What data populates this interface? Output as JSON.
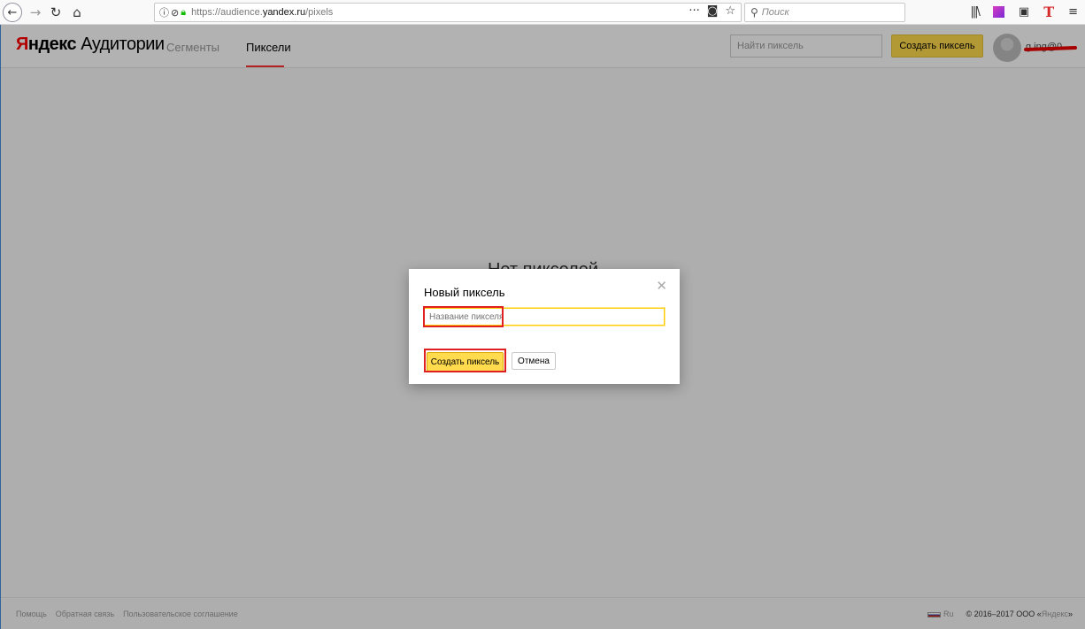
{
  "browser": {
    "url_scheme": "https://audience.",
    "url_host": "yandex.ru",
    "url_path": "/pixels",
    "search_placeholder": "Поиск",
    "icons": [
      "back-icon",
      "forward-icon",
      "reload-icon",
      "home-icon",
      "info-icon",
      "tracking-icon",
      "lock-icon",
      "more-icon",
      "pocket-icon",
      "bookmark-star-icon",
      "search-icon",
      "library-icon",
      "extension-icon",
      "sidebar-icon",
      "t-icon",
      "menu-icon"
    ]
  },
  "app": {
    "logo_first": "Я",
    "logo_rest": "ндекс",
    "logo_service": " Аудитории",
    "tabs": [
      {
        "label": "Сегменты",
        "active": false
      },
      {
        "label": "Пиксели",
        "active": true
      }
    ],
    "search_placeholder": "Найти пиксель",
    "create_button": "Создать пиксель",
    "username": "g     ing@0",
    "empty_state": "Нет пикселей"
  },
  "modal": {
    "title": "Новый пиксель",
    "name_placeholder": "Название пикселя",
    "create_button": "Создать пиксель",
    "cancel_button": "Отмена",
    "close_glyph": "✕"
  },
  "footer": {
    "links": [
      "Помощь",
      "Обратная связь",
      "Пользовательское соглашение"
    ],
    "language": "Ru",
    "copyright_prefix": "© 2016–2017 ООО «",
    "copyright_brand": "Яндекс",
    "copyright_suffix": "»"
  },
  "colors": {
    "accent_yellow": "#ffdb4d",
    "highlight_red": "#e02020",
    "tab_underline": "#ff3333"
  }
}
